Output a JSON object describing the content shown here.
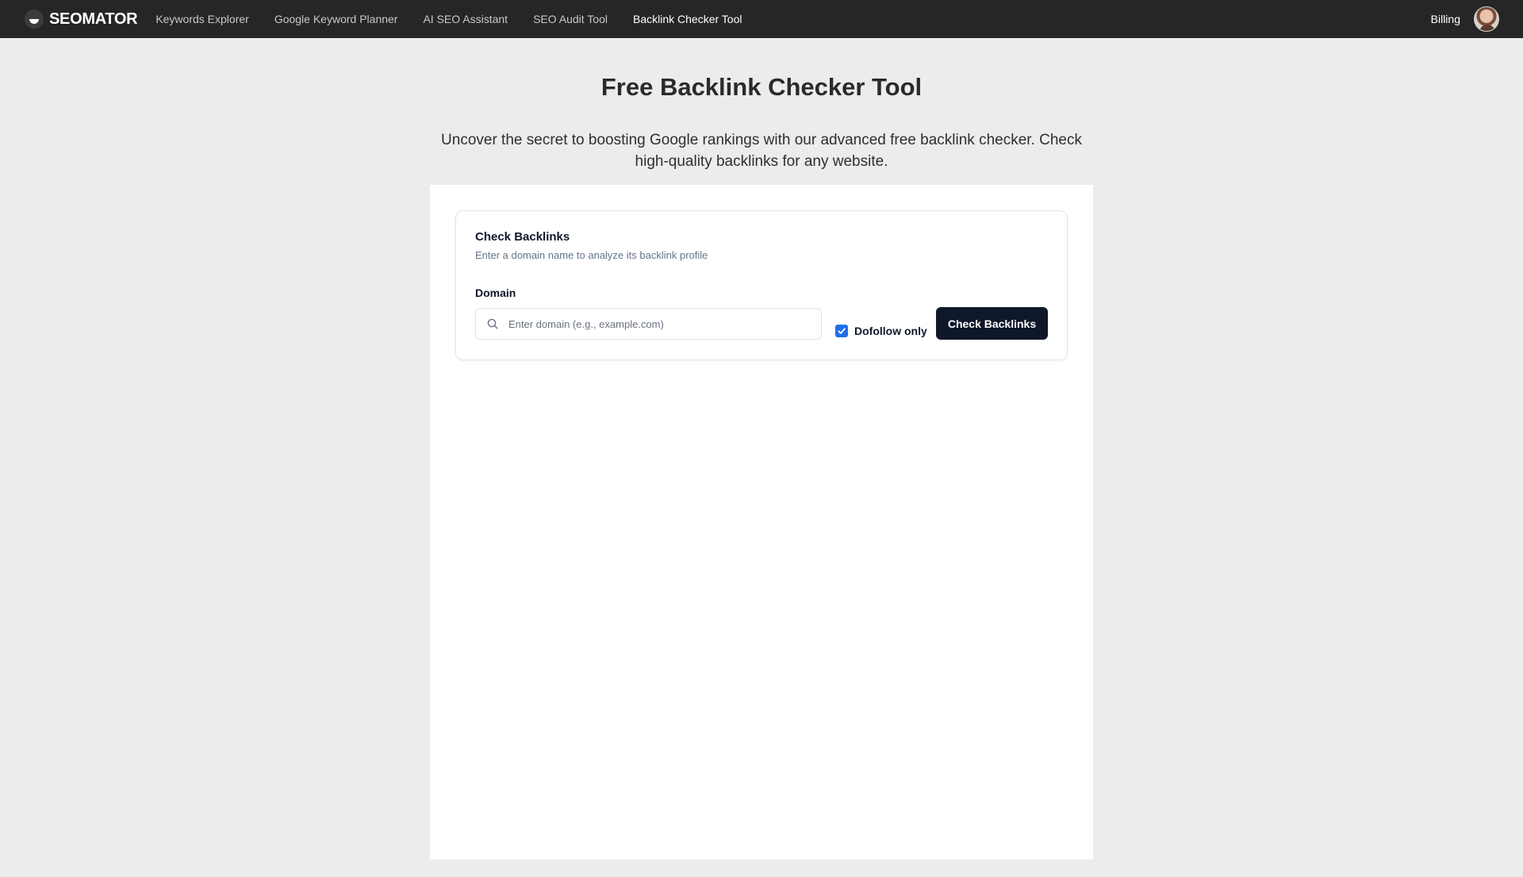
{
  "brand": {
    "name": "SEOMATOR"
  },
  "nav": {
    "items": [
      {
        "label": "Keywords Explorer"
      },
      {
        "label": "Google Keyword Planner"
      },
      {
        "label": "AI SEO Assistant"
      },
      {
        "label": "SEO Audit Tool"
      },
      {
        "label": "Backlink Checker Tool",
        "active": true
      }
    ],
    "billing_label": "Billing"
  },
  "hero": {
    "title": "Free Backlink Checker Tool",
    "description": "Uncover the secret to boosting Google rankings with our advanced free backlink checker. Check high-quality backlinks for any website."
  },
  "card": {
    "title": "Check Backlinks",
    "subtitle": "Enter a domain name to analyze its backlink profile",
    "domain_label": "Domain",
    "domain_value": "",
    "domain_placeholder": "Enter domain (e.g., example.com)",
    "dofollow_label": "Dofollow only",
    "dofollow_checked": true,
    "submit_label": "Check Backlinks"
  },
  "colors": {
    "topbar_bg": "#262626",
    "page_bg": "#ebecee",
    "button_bg": "#0f172a",
    "checkbox_accent": "#1f6feb"
  },
  "icons": {
    "logo": "seomator-logo-icon",
    "search": "search-icon",
    "check": "checkmark-icon"
  }
}
